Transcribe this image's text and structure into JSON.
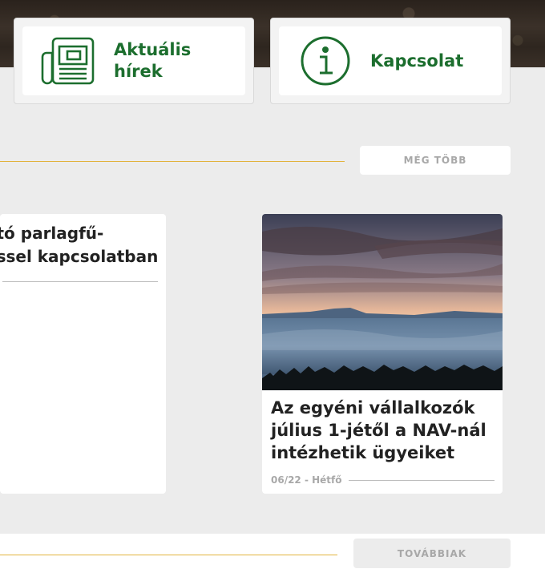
{
  "quick_links": [
    {
      "label": "Aktuális\nhírek",
      "icon": "newspaper-icon"
    },
    {
      "label": "Kapcsolat",
      "icon": "info-icon"
    }
  ],
  "section1": {
    "more_label": "MÉG TÖBB"
  },
  "news": [
    {
      "title_fragment": "ató parlagfű-\néssel kapcsolatban"
    },
    {
      "title": "Az egyéni vállalkozók július 1-jétől a NAV-nál intézhetik ügyeiket",
      "date": "06/22 - Hétfő"
    }
  ],
  "section2": {
    "further_label": "TOVÁBBIAK"
  },
  "colors": {
    "accent_green": "#1c6e2e",
    "rule_gold": "#e2b33d",
    "background": "#ececec"
  }
}
